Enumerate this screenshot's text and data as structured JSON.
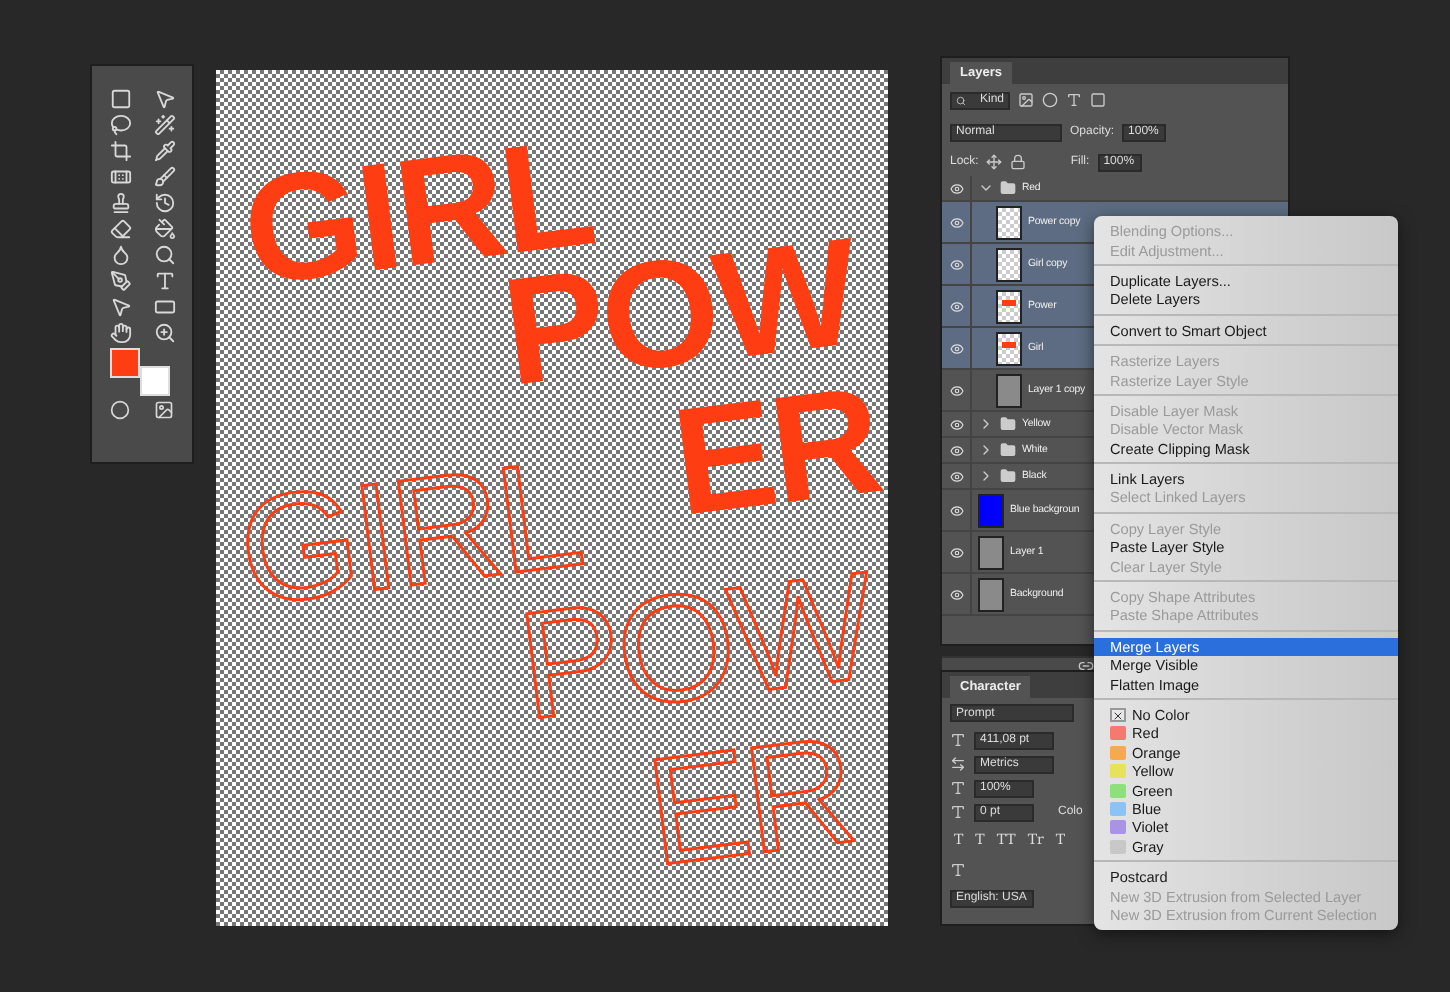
{
  "canvas": {
    "solid_words": [
      "GIRL",
      "POW",
      "ER"
    ],
    "outline_words": [
      "GIRL",
      "POW",
      "ER"
    ]
  },
  "layers_panel": {
    "title": "Layers",
    "filter": "Kind",
    "blend_mode": "Normal",
    "opacity_label": "Opacity:",
    "opacity": "100%",
    "lock_label": "Lock:",
    "fill_label": "Fill:",
    "fill": "100%",
    "layers": [
      {
        "name": "Red",
        "kind": "group",
        "expanded": true,
        "selected": false,
        "children": [
          {
            "name": "Power copy",
            "kind": "text",
            "selected": true
          },
          {
            "name": "Girl copy",
            "kind": "text",
            "selected": true
          },
          {
            "name": "Power",
            "kind": "text-red",
            "selected": true
          },
          {
            "name": "Girl",
            "kind": "text-red",
            "selected": true
          },
          {
            "name": "Layer 1 copy",
            "kind": "raster",
            "selected": false
          }
        ]
      },
      {
        "name": "Yellow",
        "kind": "group",
        "expanded": false,
        "selected": false
      },
      {
        "name": "White",
        "kind": "group",
        "expanded": false,
        "selected": false
      },
      {
        "name": "Black",
        "kind": "group",
        "expanded": false,
        "selected": false
      },
      {
        "name": "Blue backgroun",
        "kind": "fill",
        "color": "#0000ff",
        "selected": false
      },
      {
        "name": "Layer 1",
        "kind": "raster",
        "selected": false
      },
      {
        "name": "Background",
        "kind": "raster",
        "selected": false
      }
    ]
  },
  "character_panel": {
    "title": "Character",
    "font": "Prompt",
    "size": "411,08 pt",
    "kerning": "Metrics",
    "vertical_scale": "100%",
    "baseline_shift": "0 pt",
    "color_label": "Colo",
    "style_buttons": [
      "T",
      "T",
      "TT",
      "Tr",
      "T"
    ],
    "language": "English: USA"
  },
  "context_menu": {
    "sections": [
      [
        {
          "label": "Blending Options...",
          "disabled": true
        },
        {
          "label": "Edit Adjustment...",
          "disabled": true
        }
      ],
      [
        {
          "label": "Duplicate Layers...",
          "disabled": false
        },
        {
          "label": "Delete Layers",
          "disabled": false
        }
      ],
      [
        {
          "label": "Convert to Smart Object",
          "disabled": false
        }
      ],
      [
        {
          "label": "Rasterize Layers",
          "disabled": true
        },
        {
          "label": "Rasterize Layer Style",
          "disabled": true
        }
      ],
      [
        {
          "label": "Disable Layer Mask",
          "disabled": true
        },
        {
          "label": "Disable Vector Mask",
          "disabled": true
        },
        {
          "label": "Create Clipping Mask",
          "disabled": false
        }
      ],
      [
        {
          "label": "Link Layers",
          "disabled": false
        },
        {
          "label": "Select Linked Layers",
          "disabled": true
        }
      ],
      [
        {
          "label": "Copy Layer Style",
          "disabled": true
        },
        {
          "label": "Paste Layer Style",
          "disabled": false
        },
        {
          "label": "Clear Layer Style",
          "disabled": true
        }
      ],
      [
        {
          "label": "Copy Shape Attributes",
          "disabled": true
        },
        {
          "label": "Paste Shape Attributes",
          "disabled": true
        }
      ],
      [
        {
          "label": "Merge Layers",
          "disabled": false,
          "selected": true
        },
        {
          "label": "Merge Visible",
          "disabled": false,
          "selected": false
        },
        {
          "label": "Flatten Image",
          "disabled": false,
          "selected": false
        }
      ],
      [
        {
          "label": "No Color",
          "kind": "none",
          "disabled": false
        },
        {
          "label": "Red",
          "kind": "color",
          "color": "#f47a70",
          "disabled": false
        },
        {
          "label": "Orange",
          "kind": "color",
          "color": "#f7a94d",
          "disabled": false
        },
        {
          "label": "Yellow",
          "kind": "color",
          "color": "#e8e25a",
          "disabled": false
        },
        {
          "label": "Green",
          "kind": "color",
          "color": "#8ee07a",
          "disabled": false
        },
        {
          "label": "Blue",
          "kind": "color",
          "color": "#8cc3f5",
          "disabled": false
        },
        {
          "label": "Violet",
          "kind": "color",
          "color": "#a993e6",
          "disabled": false
        },
        {
          "label": "Gray",
          "kind": "color",
          "color": "#c8c8c8",
          "disabled": false
        }
      ],
      [
        {
          "label": "Postcard",
          "disabled": false
        },
        {
          "label": "New 3D Extrusion from Selected Layer",
          "disabled": true
        },
        {
          "label": "New 3D Extrusion from Current Selection",
          "disabled": true
        }
      ]
    ]
  }
}
